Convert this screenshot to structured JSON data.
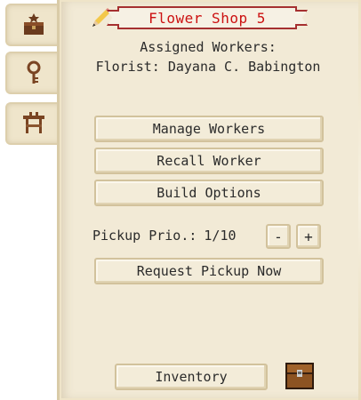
{
  "tabs": [
    {
      "icon": "chest-home-icon"
    },
    {
      "icon": "key-icon"
    },
    {
      "icon": "workbench-icon"
    }
  ],
  "header": {
    "title": "Flower Shop 5",
    "edit_icon": "pencil-icon",
    "title_color": "#cc1111"
  },
  "info": {
    "assigned_label": "Assigned Workers:",
    "worker": "Florist: Dayana C. Babington"
  },
  "actions": {
    "manage": "Manage Workers",
    "recall": "Recall Worker",
    "build": "Build Options"
  },
  "pickup": {
    "label": "Pickup Prio.:",
    "value": "1/10",
    "minus": "-",
    "plus": "+",
    "request": "Request Pickup Now"
  },
  "footer": {
    "inventory": "Inventory",
    "chest_icon": "chest-icon"
  }
}
